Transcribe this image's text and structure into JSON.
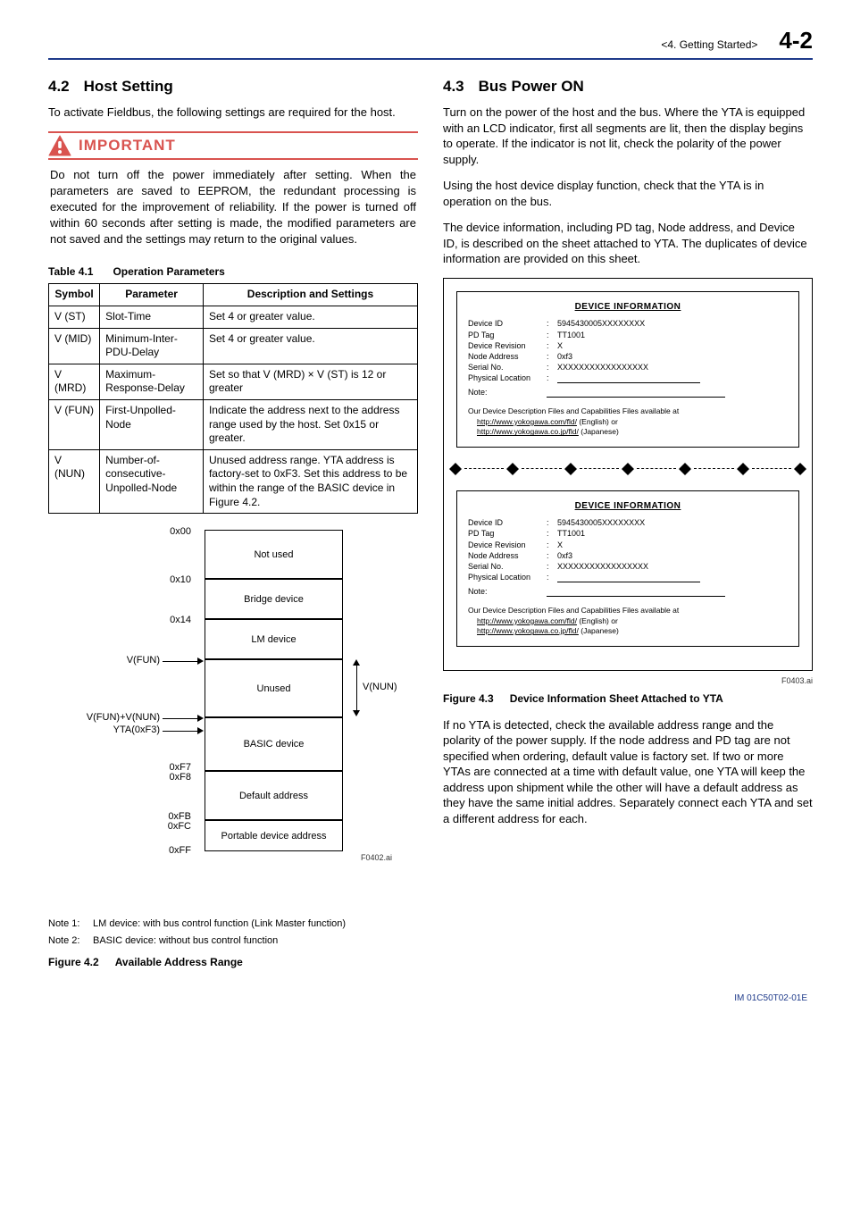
{
  "header": {
    "chapter": "<4.  Getting Started>",
    "page_num": "4-2"
  },
  "left": {
    "sec_num": "4.2",
    "sec_title": "Host Setting",
    "intro": "To activate Fieldbus, the following settings are required for the host.",
    "important": {
      "label": "IMPORTANT",
      "body": "Do not turn off the power immediately after setting. When the parameters are saved to EEPROM, the redundant processing is executed for the improvement of reliability.  If the power is turned off within 60 seconds after setting is made, the modified parameters are not saved and the settings may return to the original values."
    },
    "table_cap_num": "Table 4.1",
    "table_cap_title": "Operation Parameters",
    "table": {
      "headers": [
        "Symbol",
        "Parameter",
        "Description and Settings"
      ],
      "rows": [
        [
          "V (ST)",
          "Slot-Time",
          "Set 4 or greater value."
        ],
        [
          "V (MID)",
          "Minimum-Inter-PDU-Delay",
          "Set 4 or greater value."
        ],
        [
          "V (MRD)",
          "Maximum-Response-Delay",
          "Set so that V (MRD) × V (ST) is 12 or greater"
        ],
        [
          "V (FUN)",
          "First-Unpolled-Node",
          "Indicate the address next to the address range used by the host. Set 0x15 or greater."
        ],
        [
          "V (NUN)",
          "Number-of-consecutive-Unpolled-Node",
          "Unused address range. YTA address is factory-set to 0xF3. Set this address to be within the range of the BASIC device in Figure 4.2."
        ]
      ]
    },
    "diagram": {
      "labels": {
        "a0": "0x00",
        "a1": "0x10",
        "a2": "0x14",
        "vfun": "V(FUN)",
        "vfun_vnun": "V(FUN)+V(NUN)",
        "yta": "YTA(0xF3)",
        "f7": "0xF7",
        "f8": "0xF8",
        "fb": "0xFB",
        "fc": "0xFC",
        "ff": "0xFF",
        "vnun_side": "V(NUN)"
      },
      "boxes": {
        "not_used": "Not used",
        "bridge": "Bridge device",
        "lm": "LM device",
        "unused": "Unused",
        "basic": "BASIC device",
        "default": "Default address",
        "portable": "Portable device address"
      },
      "code": "F0402.ai"
    },
    "notes": {
      "n1_key": "Note 1:",
      "n1_body": "LM device: with bus control function (Link Master function)",
      "n2_key": "Note 2:",
      "n2_body": "BASIC device: without bus control function"
    },
    "fig_cap_num": "Figure 4.2",
    "fig_cap_title": "Available Address Range"
  },
  "right": {
    "sec_num": "4.3",
    "sec_title": "Bus Power ON",
    "p1": "Turn on the power of the host and the bus. Where the YTA is equipped with an LCD indicator, first all segments are lit, then the display begins to operate. If the indicator is not lit, check the polarity of the power supply.",
    "p2": "Using the host device display function, check that the YTA is in operation on the bus.",
    "p3": "The device information, including PD tag, Node address, and Device ID, is described on the sheet attached to YTA. The duplicates of device information are provided on this sheet.",
    "devsheet": {
      "title": "DEVICE INFORMATION",
      "fields": [
        {
          "k": "Device ID",
          "v": "5945430005XXXXXXXX"
        },
        {
          "k": "PD Tag",
          "v": "TT1001"
        },
        {
          "k": "Device Revision",
          "v": "X"
        },
        {
          "k": "Node Address",
          "v": "0xf3"
        },
        {
          "k": "Serial No.",
          "v": "XXXXXXXXXXXXXXXXX"
        },
        {
          "k": "Physical Location",
          "v": ""
        }
      ],
      "note_label": "Note:",
      "avail_text": "Our Device Description Files and Capabilities Files available at",
      "link1_url": "http://www.yokogawa.com/fld/",
      "link1_lang": "(English)   or",
      "link2_url": "http://www.yokogawa.co.jp/fld/",
      "link2_lang": "(Japanese)"
    },
    "sheet_code": "F0403.ai",
    "fig_cap_num": "Figure 4.3",
    "fig_cap_title": "Device Information Sheet Attached to YTA",
    "p4": "If no YTA is detected, check the available address range and the polarity of the power supply. If the node address and PD tag are not specified when ordering, default value is factory set. If two or more YTAs are connected at a time with default value, one YTA will keep the address upon shipment while the other will have a default address as they have the same initial addres. Separately connect each YTA and set a different address for each."
  },
  "footer": {
    "doc_id": "IM 01C50T02-01E"
  }
}
